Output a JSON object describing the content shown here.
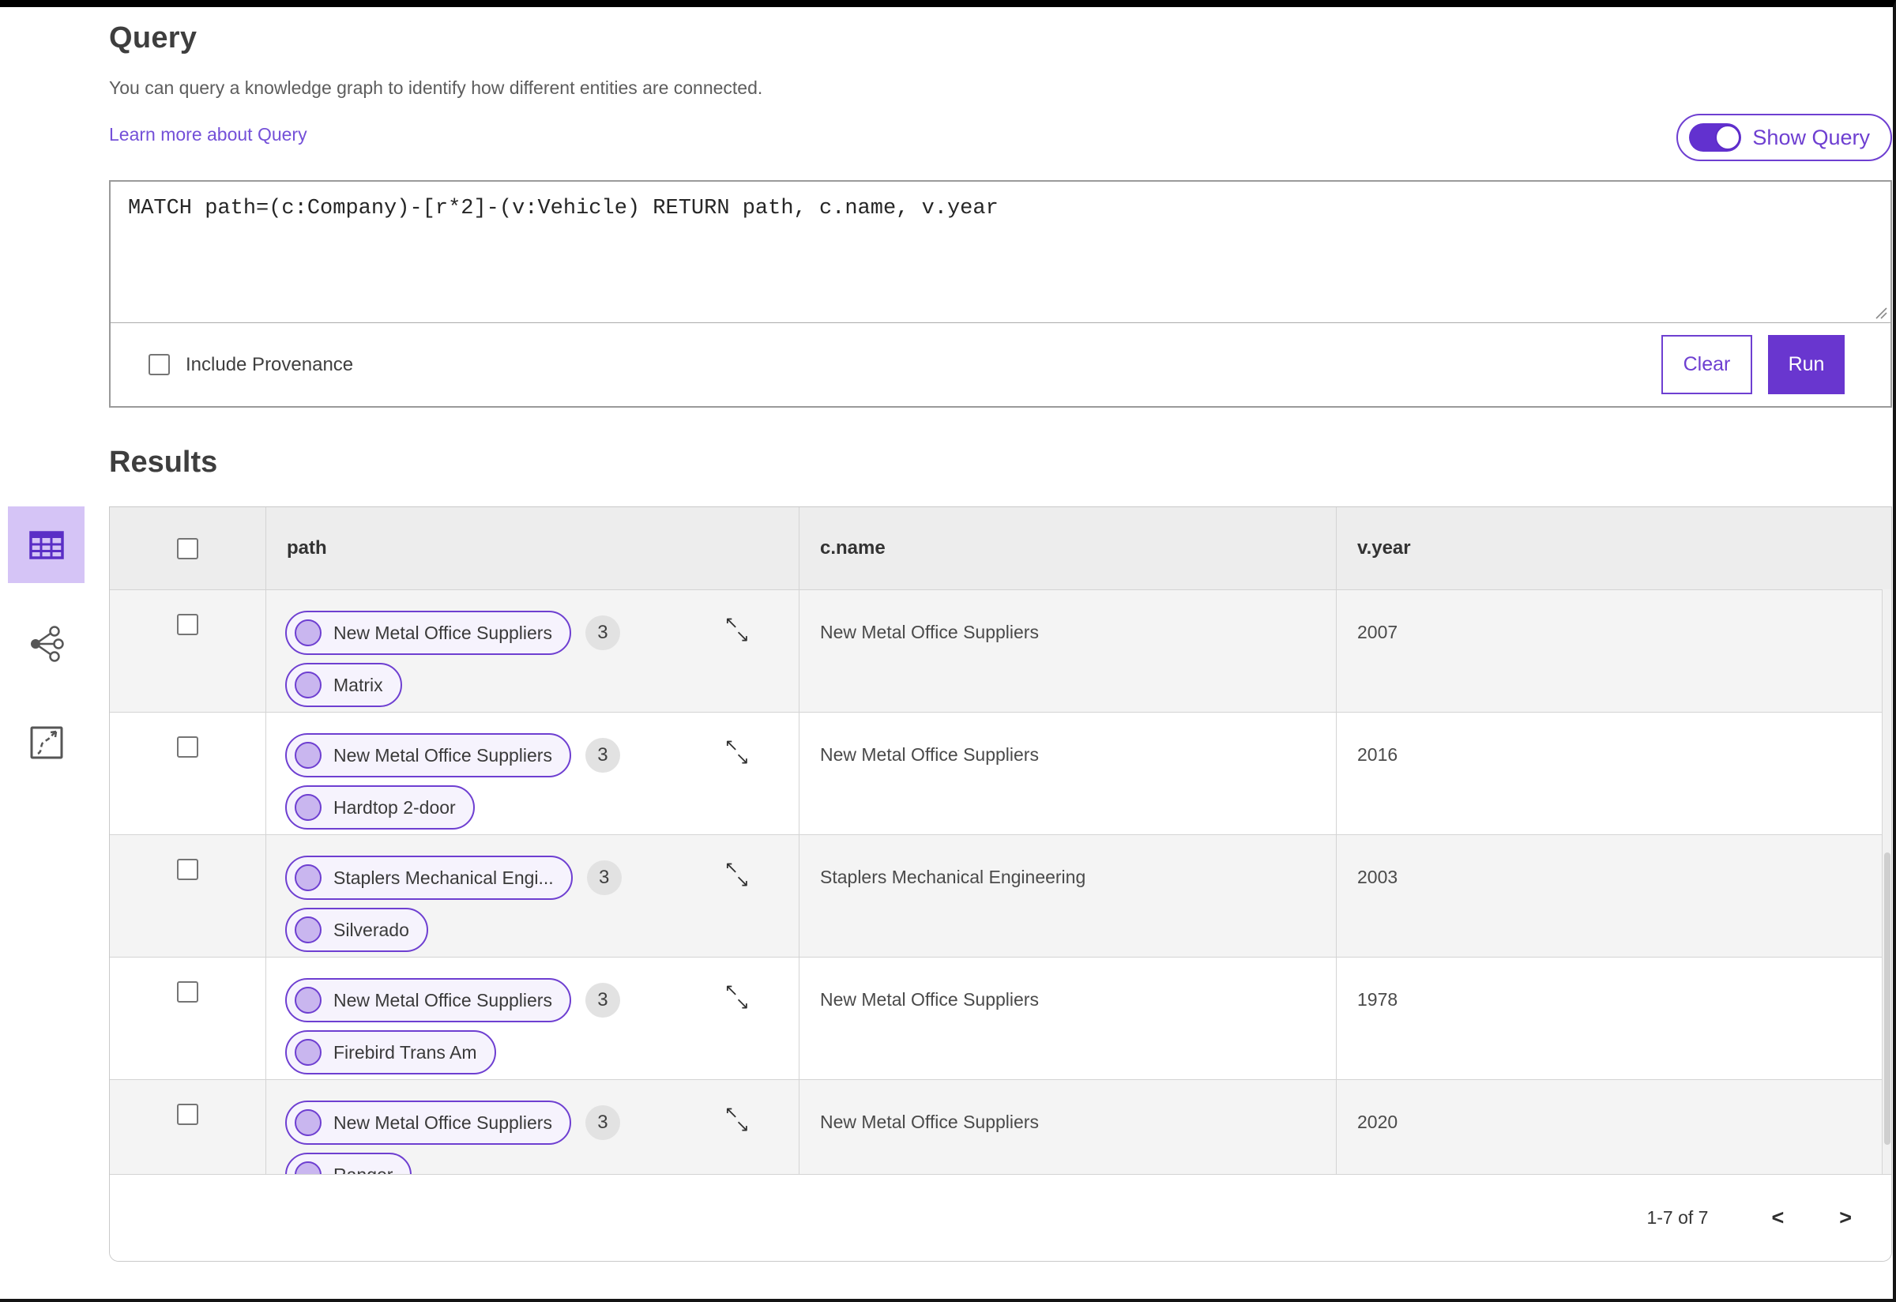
{
  "header": {
    "title": "Query",
    "description": "You can query a knowledge graph to identify how different entities are connected.",
    "learn_more": "Learn more about Query",
    "show_query_label": "Show Query"
  },
  "query_panel": {
    "query_text": "MATCH path=(c:Company)-[r*2]-(v:Vehicle) RETURN path, c.name, v.year",
    "include_provenance_label": "Include Provenance",
    "clear_label": "Clear",
    "run_label": "Run"
  },
  "results": {
    "title": "Results",
    "columns": [
      "path",
      "c.name",
      "v.year"
    ],
    "rows": [
      {
        "pill1": "New Metal Office Suppliers",
        "count": "3",
        "pill2": "Matrix",
        "c_name": "New Metal Office Suppliers",
        "v_year": "2007"
      },
      {
        "pill1": "New Metal Office Suppliers",
        "count": "3",
        "pill2": "Hardtop 2-door",
        "c_name": "New Metal Office Suppliers",
        "v_year": "2016"
      },
      {
        "pill1": "Staplers Mechanical Engi...",
        "count": "3",
        "pill2": "Silverado",
        "c_name": "Staplers Mechanical Engineering",
        "v_year": "2003"
      },
      {
        "pill1": "New Metal Office Suppliers",
        "count": "3",
        "pill2": "Firebird Trans Am",
        "c_name": "New Metal Office Suppliers",
        "v_year": "1978"
      },
      {
        "pill1": "New Metal Office Suppliers",
        "count": "3",
        "pill2": "Ranger",
        "c_name": "New Metal Office Suppliers",
        "v_year": "2020"
      }
    ],
    "pagination": {
      "range_label": "1-7 of 7",
      "prev": "<",
      "next": ">"
    }
  },
  "icons": {
    "view_icons": [
      "table-view-icon",
      "network-view-icon",
      "chart-view-icon"
    ],
    "expand": "expand-icon",
    "node": "node-icon",
    "toggle": "toggle-switch-icon",
    "resize": "resize-grip-icon"
  },
  "colors": {
    "accent": "#6e3fd1",
    "accent_light": "#f6f3fd",
    "node_fill": "#c9b6ef",
    "selected_icon_bg": "#d5c4f6",
    "run_bg": "#6936cf",
    "link": "#7450d8",
    "header_bg": "#ededed",
    "row_alt_bg": "#f4f4f4"
  }
}
